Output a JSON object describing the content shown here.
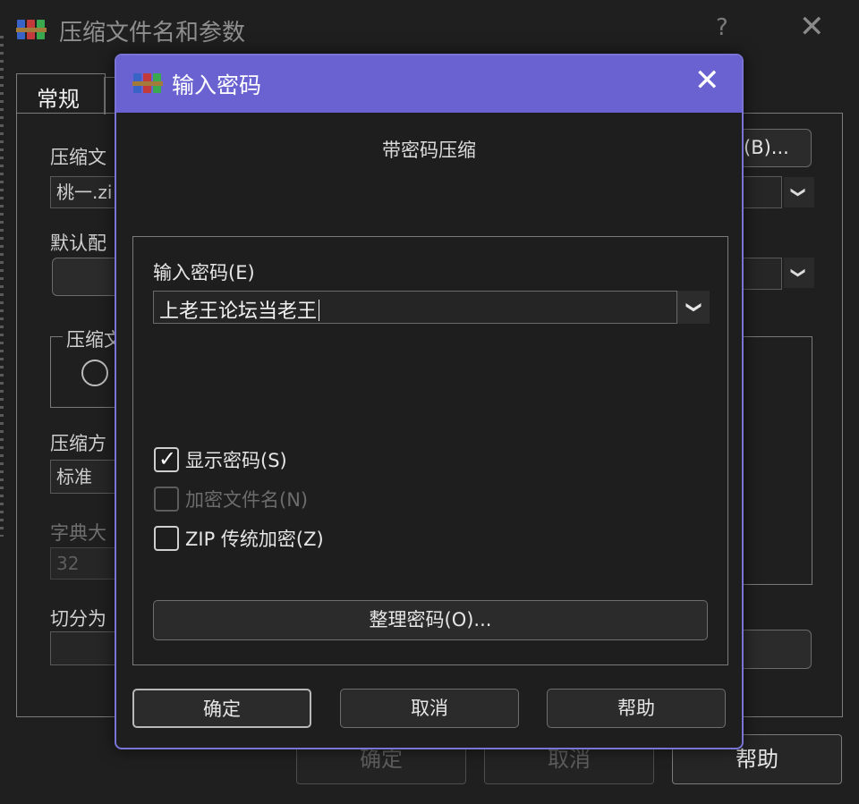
{
  "colors": {
    "accent": "#6a62d0",
    "background": "#1f1f1f"
  },
  "background_window": {
    "title": "压缩文件名和参数",
    "help_glyph": "?",
    "close_glyph": "✕",
    "tab_general": "常规",
    "archive_name_label": "压缩文",
    "archive_name_value": "桃一.zi",
    "browse_button_partial": "(B)...",
    "default_profile_label": "默认配",
    "format_group_label": "压缩文",
    "method_label": "压缩方",
    "method_value": "标准",
    "dictionary_label": "字典大",
    "dictionary_value": "32",
    "split_label": "切分为",
    "ok_button": "确定",
    "cancel_button": "取消",
    "help_button": "帮助",
    "chevron": "❯"
  },
  "dialog": {
    "title": "输入密码",
    "close_glyph": "✕",
    "subtitle": "带密码压缩",
    "password_label": "输入密码(E)",
    "password_value": "上老王论坛当老王",
    "chevron": "❯",
    "show_password": {
      "label": "显示密码(S)",
      "checked": true,
      "check_glyph": "✓"
    },
    "encrypt_filenames": {
      "label": "加密文件名(N)",
      "checked": false,
      "enabled": false
    },
    "zip_legacy": {
      "label": "ZIP 传统加密(Z)",
      "checked": false
    },
    "organize_button": "整理密码(O)...",
    "ok_button": "确定",
    "cancel_button": "取消",
    "help_button": "帮助"
  }
}
